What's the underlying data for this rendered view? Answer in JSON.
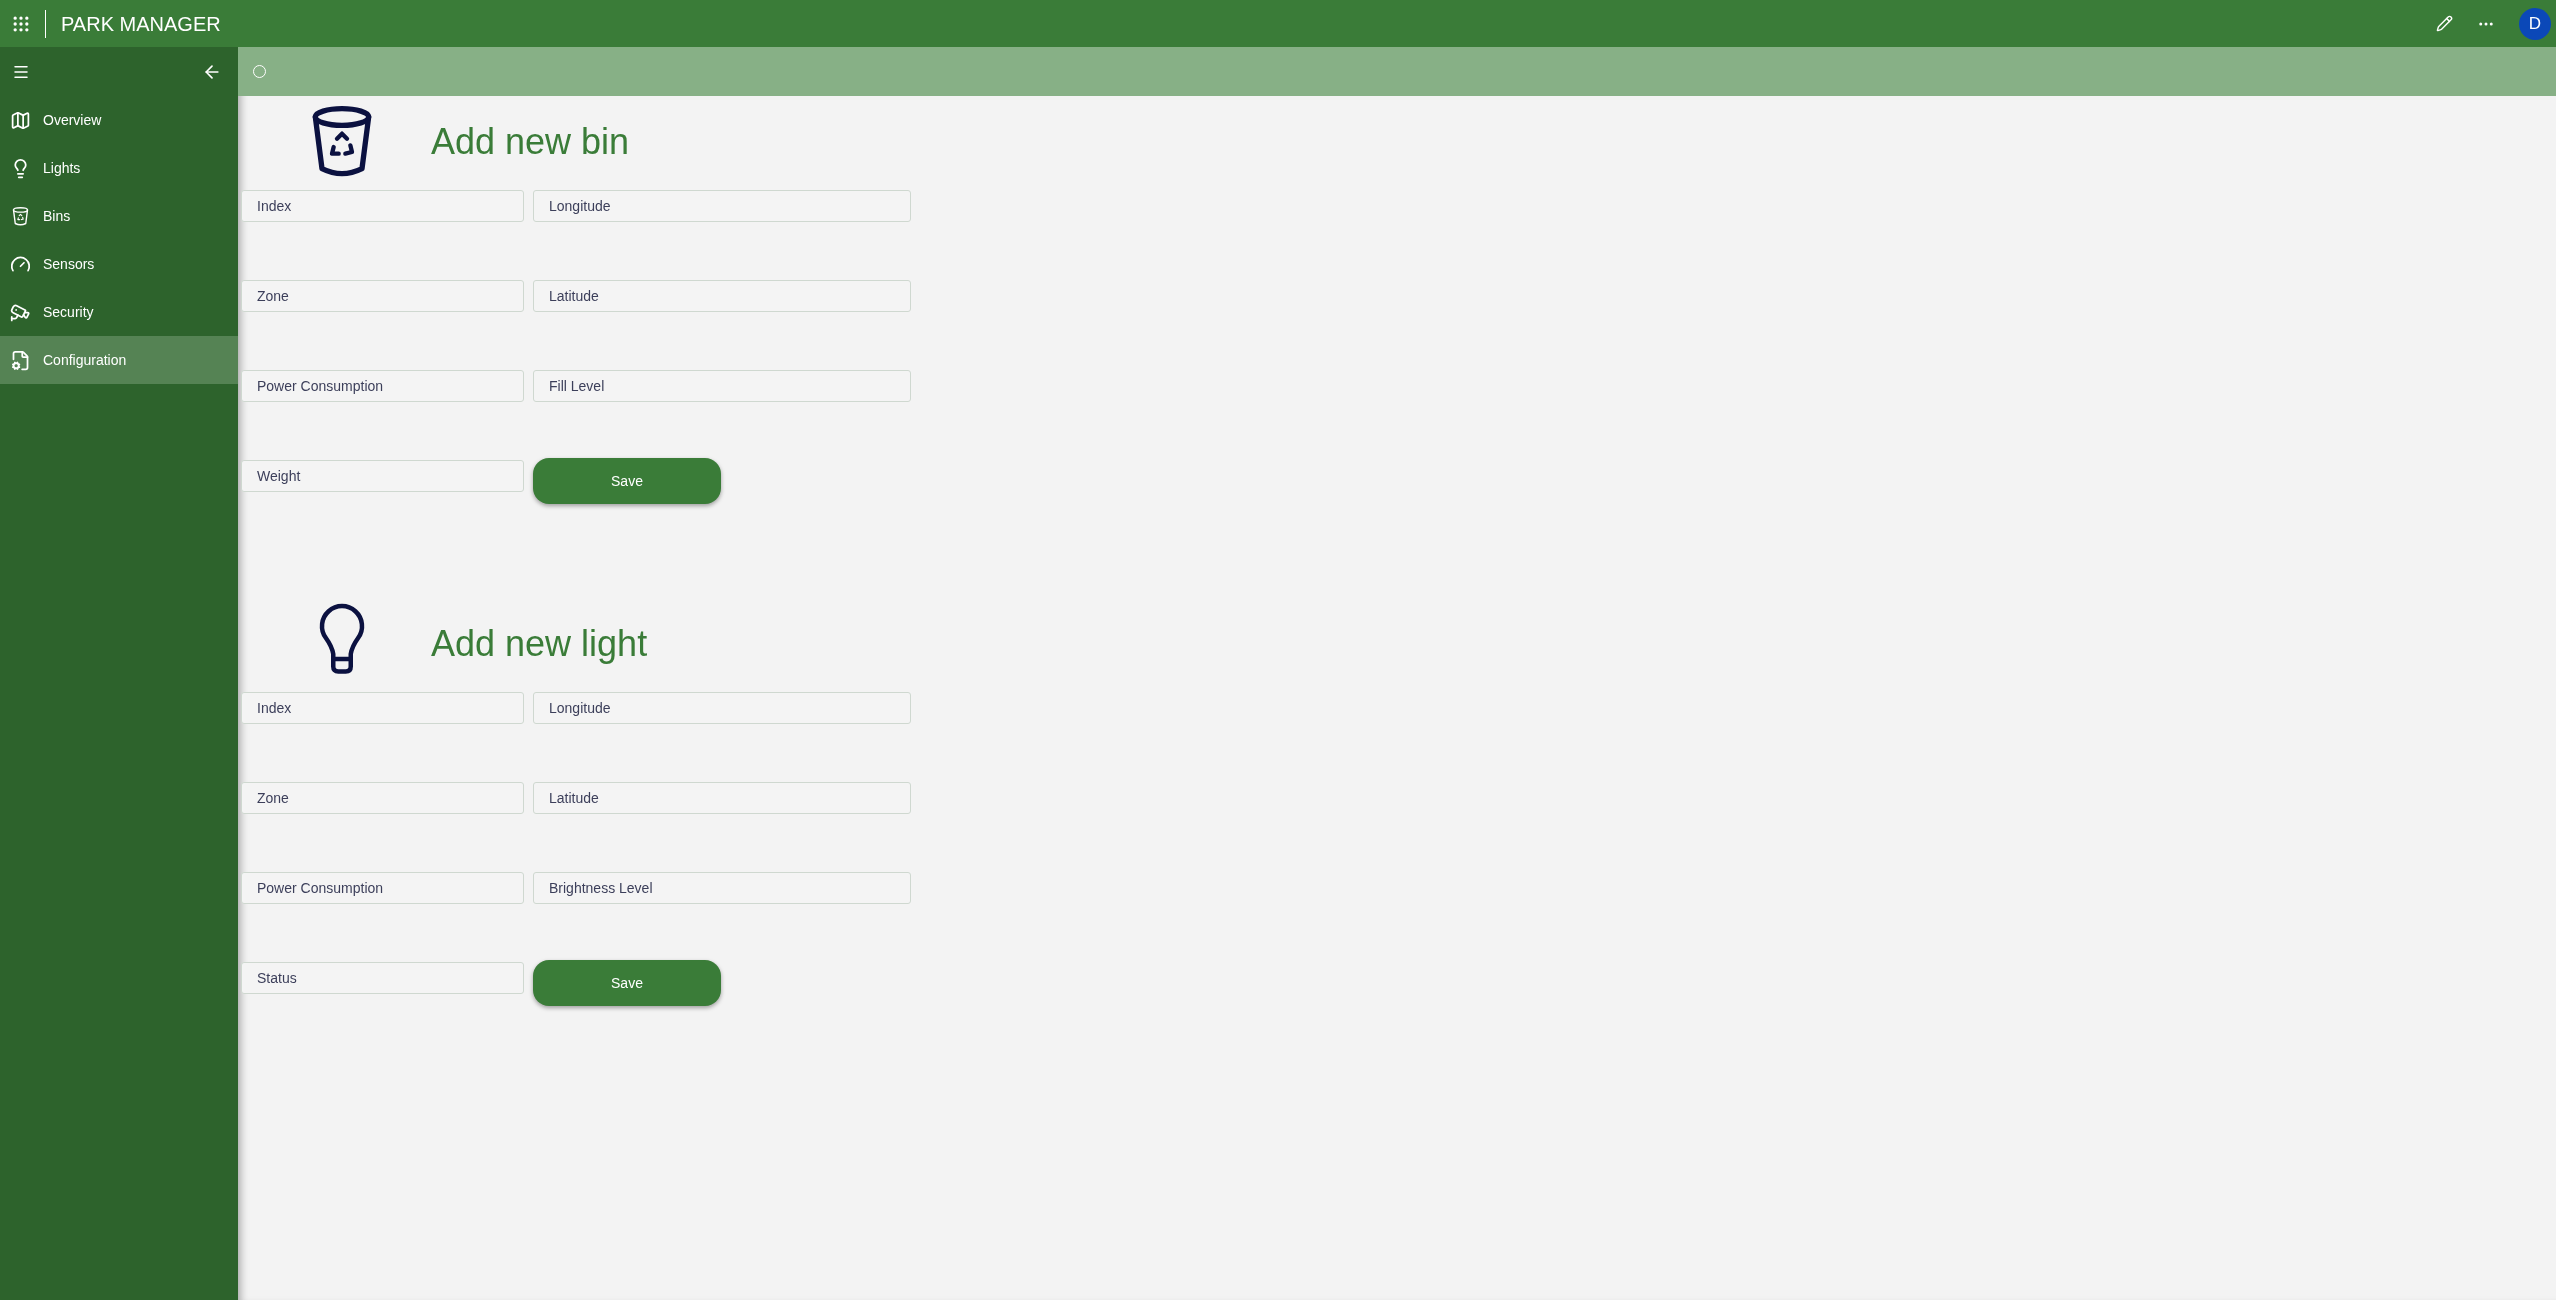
{
  "app": {
    "title": "PARK MANAGER",
    "avatar": "D"
  },
  "sidebar": {
    "items": [
      {
        "kind": "map",
        "label": "Overview",
        "selected": false
      },
      {
        "kind": "bulb",
        "label": "Lights",
        "selected": false
      },
      {
        "kind": "bin",
        "label": "Bins",
        "selected": false
      },
      {
        "kind": "gauge",
        "label": "Sensors",
        "selected": false
      },
      {
        "kind": "camera",
        "label": "Security",
        "selected": false
      },
      {
        "kind": "config",
        "label": "Configuration",
        "selected": true
      }
    ]
  },
  "forms": [
    {
      "kind": "bin",
      "title": "Add new bin",
      "fields": [
        {
          "placeholder": "Index"
        },
        {
          "placeholder": "Longitude"
        },
        {
          "placeholder": "Zone"
        },
        {
          "placeholder": "Latitude"
        },
        {
          "placeholder": "Power Consumption"
        },
        {
          "placeholder": "Fill Level"
        },
        {
          "placeholder": "Weight"
        }
      ],
      "button": "Save"
    },
    {
      "kind": "light",
      "title": "Add new light",
      "fields": [
        {
          "placeholder": "Index"
        },
        {
          "placeholder": "Longitude"
        },
        {
          "placeholder": "Zone"
        },
        {
          "placeholder": "Latitude"
        },
        {
          "placeholder": "Power Consumption"
        },
        {
          "placeholder": "Brightness Level"
        },
        {
          "placeholder": "Status"
        }
      ],
      "button": "Save"
    }
  ]
}
